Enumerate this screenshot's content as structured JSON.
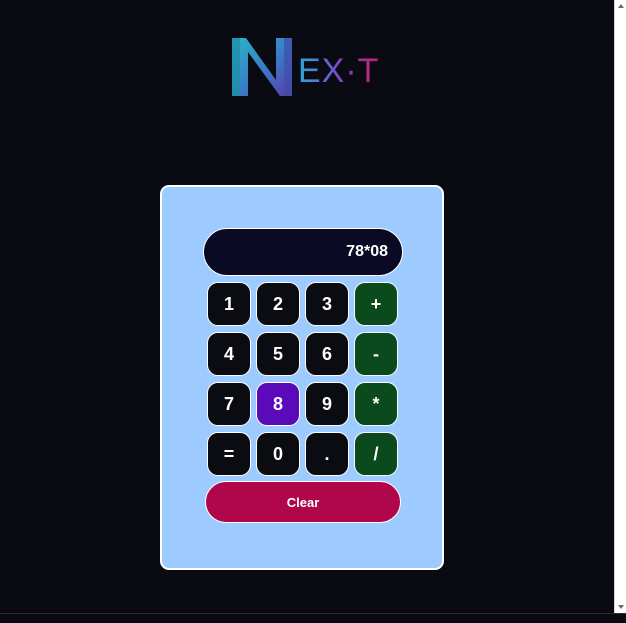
{
  "logo": {
    "letter": "N",
    "rest": "EX·T",
    "icon": "next-logo-icon"
  },
  "calculator": {
    "display": "78*08",
    "keys": [
      {
        "label": "1",
        "type": "digit",
        "active": false
      },
      {
        "label": "2",
        "type": "digit",
        "active": false
      },
      {
        "label": "3",
        "type": "digit",
        "active": false
      },
      {
        "label": "+",
        "type": "operator",
        "active": false
      },
      {
        "label": "4",
        "type": "digit",
        "active": false
      },
      {
        "label": "5",
        "type": "digit",
        "active": false
      },
      {
        "label": "6",
        "type": "digit",
        "active": false
      },
      {
        "label": "-",
        "type": "operator",
        "active": false
      },
      {
        "label": "7",
        "type": "digit",
        "active": false
      },
      {
        "label": "8",
        "type": "digit",
        "active": true
      },
      {
        "label": "9",
        "type": "digit",
        "active": false
      },
      {
        "label": "*",
        "type": "operator",
        "active": false
      },
      {
        "label": "=",
        "type": "digit",
        "active": false
      },
      {
        "label": "0",
        "type": "digit",
        "active": false
      },
      {
        "label": ".",
        "type": "digit",
        "active": false
      },
      {
        "label": "/",
        "type": "operator",
        "active": false
      }
    ],
    "clear_label": "Clear"
  },
  "colors": {
    "page_background": "#0a0b12",
    "panel_background": "#9ecbff",
    "display_background": "#0b0a25",
    "key_background": "#0b0c11",
    "operator_background": "#0b4a1c",
    "active_key_background": "#5a0ab8",
    "clear_background": "#b0064a"
  }
}
